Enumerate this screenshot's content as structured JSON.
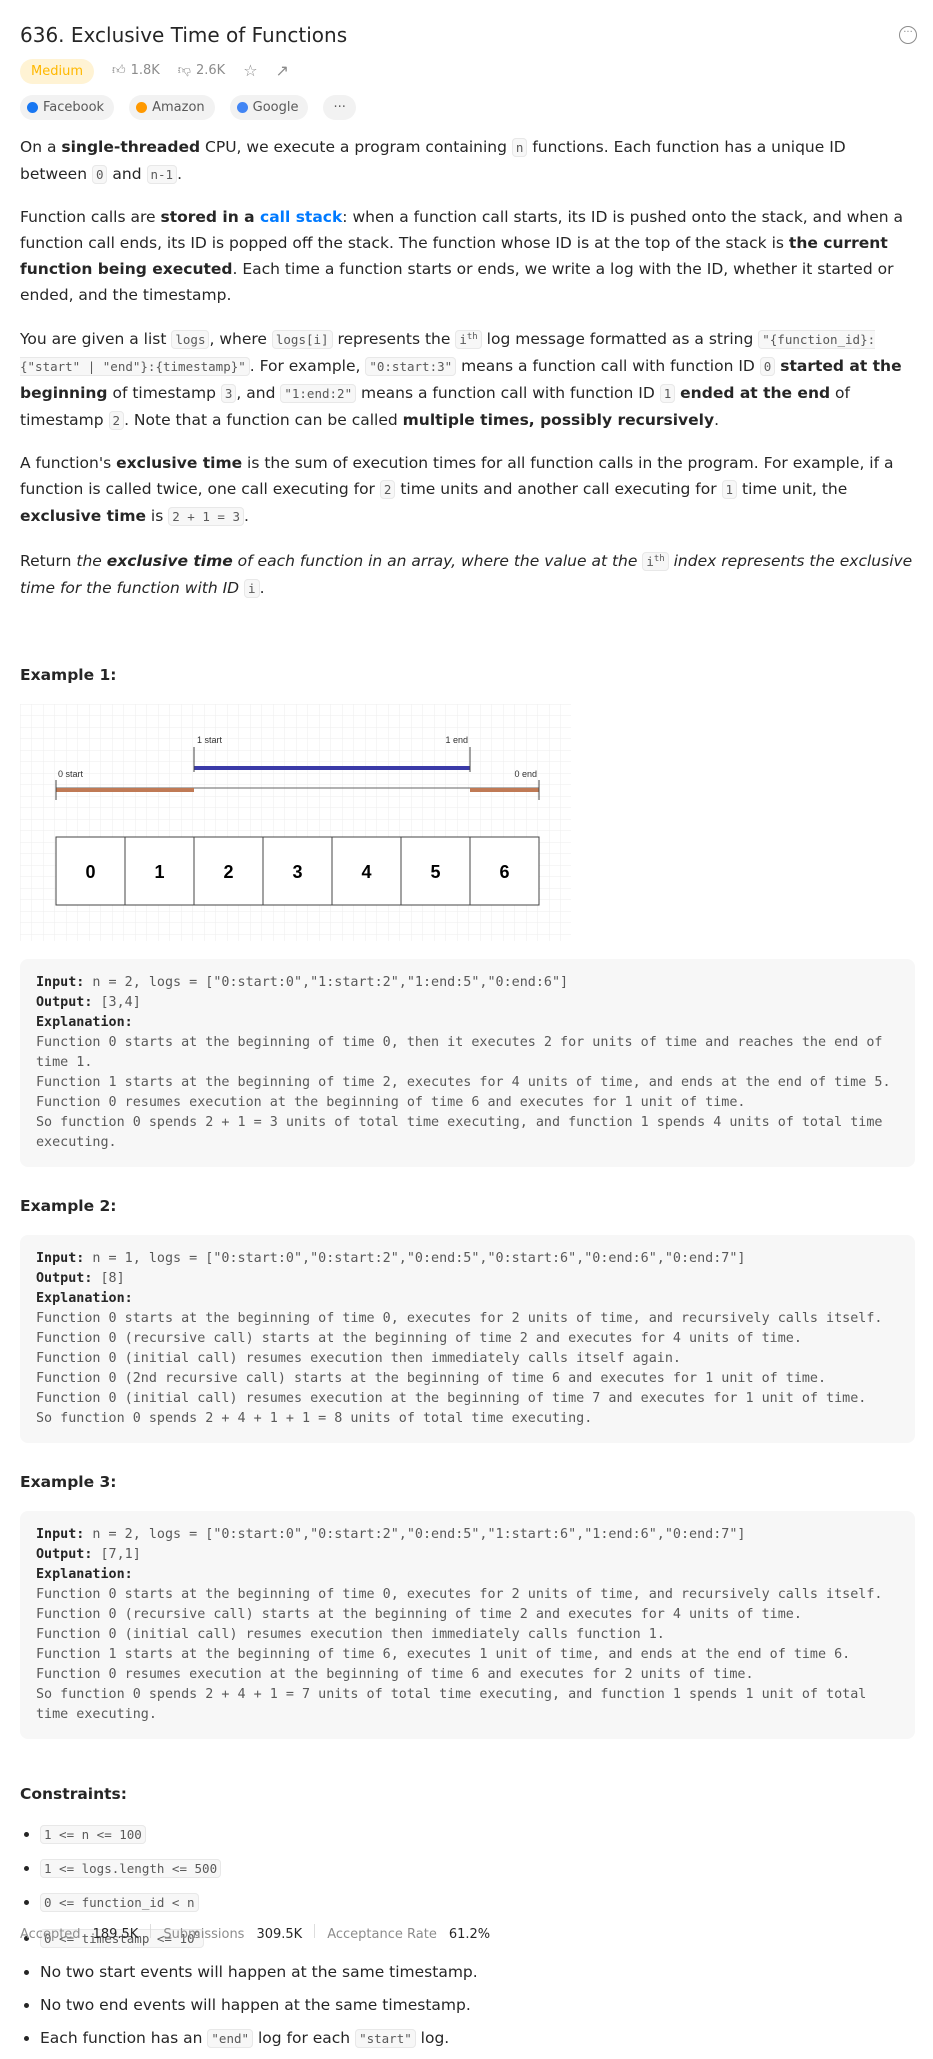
{
  "title": "636. Exclusive Time of Functions",
  "difficulty": "Medium",
  "likes": "1.8K",
  "dislikes": "2.6K",
  "companies": [
    {
      "name": "Facebook",
      "color": "#1877f2"
    },
    {
      "name": "Amazon",
      "color": "#ff9900"
    },
    {
      "name": "Google",
      "color": "#4285f4"
    }
  ],
  "more_companies": "···",
  "paragraphs": [
    [
      [
        "On a ",
        ""
      ],
      [
        "single-threaded",
        "b"
      ],
      [
        " CPU, we execute a program containing ",
        ""
      ],
      [
        "n",
        "c"
      ],
      [
        " functions. Each function has a unique ID between ",
        ""
      ],
      [
        "0",
        "c"
      ],
      [
        " and ",
        ""
      ],
      [
        "n-1",
        "c"
      ],
      [
        ".",
        ""
      ]
    ],
    [
      [
        "Function calls are ",
        ""
      ],
      [
        "stored in a ",
        "b"
      ],
      [
        "call stack",
        "a"
      ],
      [
        ": when a function call starts, its ID is pushed onto the stack, and when a function call ends, its ID is popped off the stack. The function whose ID is at the top of the stack is ",
        ""
      ],
      [
        "the current function being executed",
        "b"
      ],
      [
        ". Each time a function starts or ends, we write a log with the ID, whether it started or ended, and the timestamp.",
        ""
      ]
    ],
    [
      [
        "You are given a list ",
        ""
      ],
      [
        "logs",
        "c"
      ],
      [
        ", where ",
        ""
      ],
      [
        "logs[i]",
        "c"
      ],
      [
        " represents the ",
        ""
      ],
      [
        "ith",
        "csup"
      ],
      [
        " log message formatted as a string ",
        ""
      ],
      [
        "\"{function_id}:{\"start\" | \"end\"}:{timestamp}\"",
        "c"
      ],
      [
        ". For example, ",
        ""
      ],
      [
        "\"0:start:3\"",
        "c"
      ],
      [
        " means a function call with function ID ",
        ""
      ],
      [
        "0",
        "c"
      ],
      [
        " ",
        ""
      ],
      [
        "started at the beginning",
        "b"
      ],
      [
        " of timestamp ",
        ""
      ],
      [
        "3",
        "c"
      ],
      [
        ", and ",
        ""
      ],
      [
        "\"1:end:2\"",
        "c"
      ],
      [
        " means a function call with function ID ",
        ""
      ],
      [
        "1",
        "c"
      ],
      [
        " ",
        ""
      ],
      [
        "ended at the end",
        "b"
      ],
      [
        " of timestamp ",
        ""
      ],
      [
        "2",
        "c"
      ],
      [
        ". Note that a function can be called ",
        ""
      ],
      [
        "multiple times, possibly recursively",
        "b"
      ],
      [
        ".",
        ""
      ]
    ],
    [
      [
        "A function's ",
        ""
      ],
      [
        "exclusive time",
        "b"
      ],
      [
        " is the sum of execution times for all function calls in the program. For example, if a function is called twice, one call executing for ",
        ""
      ],
      [
        "2",
        "c"
      ],
      [
        " time units and another call executing for ",
        ""
      ],
      [
        "1",
        "c"
      ],
      [
        " time unit, the ",
        ""
      ],
      [
        "exclusive time",
        "b"
      ],
      [
        " is ",
        ""
      ],
      [
        "2 + 1 = 3",
        "c"
      ],
      [
        ".",
        ""
      ]
    ],
    [
      [
        "Return ",
        ""
      ],
      [
        "the ",
        "i"
      ],
      [
        "exclusive time",
        "bi"
      ],
      [
        " of each function in an array, where the value at the ",
        "i"
      ],
      [
        "ith",
        "csup"
      ],
      [
        " index represents the exclusive time for the function with ID ",
        "i"
      ],
      [
        "i",
        "c"
      ],
      [
        ".",
        ""
      ]
    ]
  ],
  "diagram": {
    "labels": {
      "s0": "0 start",
      "e0": "0 end",
      "s1": "1 start",
      "e1": "1 end"
    },
    "cells": [
      "0",
      "1",
      "2",
      "3",
      "4",
      "5",
      "6"
    ],
    "colors": {
      "f0": "#c07a55",
      "f1": "#3a3aa8"
    }
  },
  "examples": [
    {
      "heading": "Example 1:",
      "input_label": "Input:",
      "input": " n = 2, logs = [\"0:start:0\",\"1:start:2\",\"1:end:5\",\"0:end:6\"]",
      "output_label": "Output:",
      "output": " [3,4]",
      "explanation_label": "Explanation:",
      "explanation": "Function 0 starts at the beginning of time 0, then it executes 2 for units of time and reaches the end of time 1.\nFunction 1 starts at the beginning of time 2, executes for 4 units of time, and ends at the end of time 5.\nFunction 0 resumes execution at the beginning of time 6 and executes for 1 unit of time.\nSo function 0 spends 2 + 1 = 3 units of total time executing, and function 1 spends 4 units of total time executing."
    },
    {
      "heading": "Example 2:",
      "input_label": "Input:",
      "input": " n = 1, logs = [\"0:start:0\",\"0:start:2\",\"0:end:5\",\"0:start:6\",\"0:end:6\",\"0:end:7\"]",
      "output_label": "Output:",
      "output": " [8]",
      "explanation_label": "Explanation:",
      "explanation": "Function 0 starts at the beginning of time 0, executes for 2 units of time, and recursively calls itself.\nFunction 0 (recursive call) starts at the beginning of time 2 and executes for 4 units of time.\nFunction 0 (initial call) resumes execution then immediately calls itself again.\nFunction 0 (2nd recursive call) starts at the beginning of time 6 and executes for 1 unit of time.\nFunction 0 (initial call) resumes execution at the beginning of time 7 and executes for 1 unit of time.\nSo function 0 spends 2 + 4 + 1 + 1 = 8 units of total time executing."
    },
    {
      "heading": "Example 3:",
      "input_label": "Input:",
      "input": " n = 2, logs = [\"0:start:0\",\"0:start:2\",\"0:end:5\",\"1:start:6\",\"1:end:6\",\"0:end:7\"]",
      "output_label": "Output:",
      "output": " [7,1]",
      "explanation_label": "Explanation:",
      "explanation": "Function 0 starts at the beginning of time 0, executes for 2 units of time, and recursively calls itself.\nFunction 0 (recursive call) starts at the beginning of time 2 and executes for 4 units of time.\nFunction 0 (initial call) resumes execution then immediately calls function 1.\nFunction 1 starts at the beginning of time 6, executes 1 unit of time, and ends at the end of time 6.\nFunction 0 resumes execution at the beginning of time 6 and executes for 2 units of time.\nSo function 0 spends 2 + 4 + 1 = 7 units of total time executing, and function 1 spends 1 unit of total time executing."
    }
  ],
  "constraints_heading": "Constraints:",
  "constraints": [
    [
      [
        "1 <= n <= 100",
        "c"
      ]
    ],
    [
      [
        "1 <= logs.length <= 500",
        "c"
      ]
    ],
    [
      [
        "0 <= function_id < n",
        "c"
      ]
    ],
    [
      [
        "0 <= timestamp <= 109",
        "c"
      ]
    ],
    [
      [
        "No two start events will happen at the same timestamp.",
        ""
      ]
    ],
    [
      [
        "No two end events will happen at the same timestamp.",
        ""
      ]
    ],
    [
      [
        "Each function has an ",
        ""
      ],
      [
        "\"end\"",
        "c"
      ],
      [
        " log for each ",
        ""
      ],
      [
        "\"start\"",
        "c"
      ],
      [
        " log.",
        ""
      ]
    ]
  ],
  "footer": {
    "accepted_label": "Accepted",
    "accepted": "189.5K",
    "submissions_label": "Submissions",
    "submissions": "309.5K",
    "rate_label": "Acceptance Rate",
    "rate": "61.2%"
  }
}
